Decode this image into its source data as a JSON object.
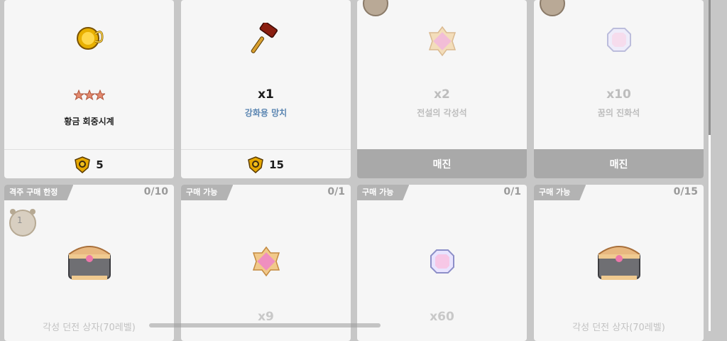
{
  "top_cards": [
    {
      "qty": "",
      "name": "황금 회중시계",
      "price": "5",
      "icon": "gold-pocket-watch-icon",
      "stars": 3
    },
    {
      "qty": "x1",
      "name": "강화용 망치",
      "price": "15",
      "icon": "hammer-icon"
    },
    {
      "qty": "x2",
      "name": "전설의 각성석",
      "status": "매진",
      "icon": "awakening-stone-icon"
    },
    {
      "qty": "x10",
      "name": "꿈의 진화석",
      "status": "매진",
      "icon": "evolution-stone-icon"
    }
  ],
  "bottom_cards": [
    {
      "tag": "격주 구매 한정",
      "limit": "0/10",
      "name": "각성 던전 상자(70레벨)",
      "qty": "",
      "clock_label": "1",
      "icon": "dungeon-chest-icon"
    },
    {
      "tag": "구매 가능",
      "limit": "0/1",
      "qty": "x9",
      "name": "",
      "icon": "awakening-stone-icon"
    },
    {
      "tag": "구매 가능",
      "limit": "0/1",
      "qty": "x60",
      "name": "",
      "icon": "evolution-stone-icon"
    },
    {
      "tag": "구매 가능",
      "limit": "0/15",
      "name": "각성 던전 상자(70레벨)",
      "qty": "",
      "icon": "dungeon-chest-icon"
    }
  ],
  "colors": {
    "card_bg": "#f6f6f6",
    "sold_out_bg": "#a9a9a9",
    "tag_bg": "#b3b3b3",
    "name_blue": "#5b86b2",
    "page_bg": "#c7c7c7"
  }
}
